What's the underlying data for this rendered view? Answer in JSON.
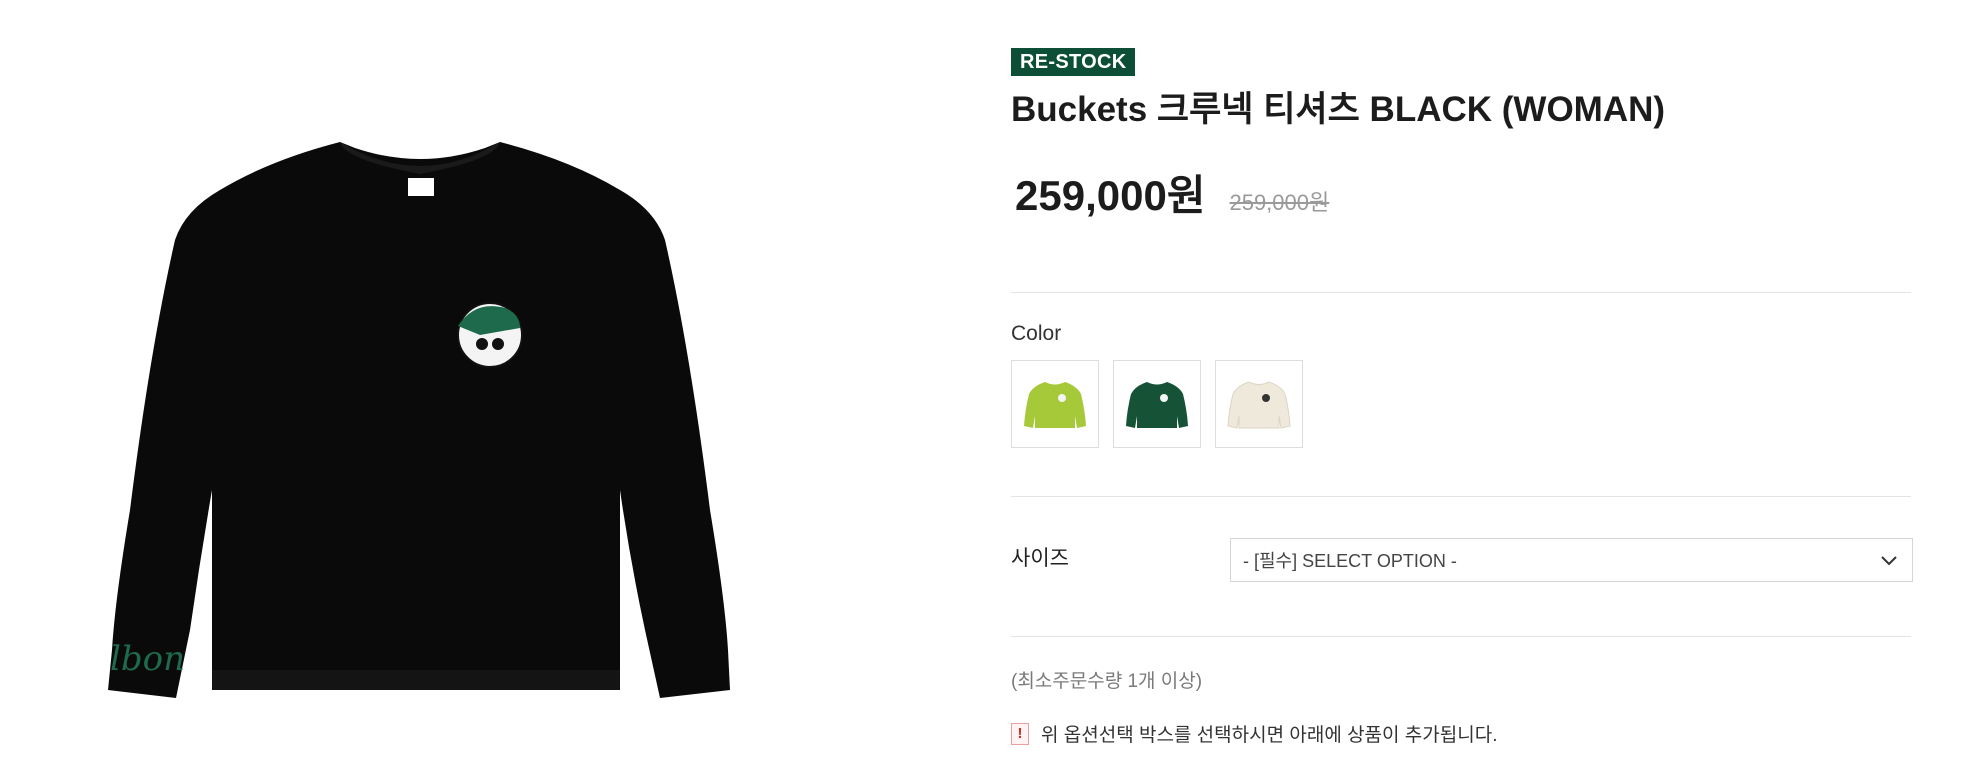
{
  "product": {
    "badge": "RE-STOCK",
    "title": "Buckets 크루넥 티셔츠 BLACK (WOMAN)",
    "price": "259,000원",
    "original_price": "259,000원",
    "main_image": {
      "icon": "black-sweatshirt-image",
      "color": "#0a0a0a"
    }
  },
  "color_option": {
    "label": "Color",
    "swatches": [
      {
        "name": "lime",
        "color": "#a6c93a",
        "icon": "lime-sweatshirt-thumbnail"
      },
      {
        "name": "green",
        "color": "#155236",
        "icon": "green-sweatshirt-thumbnail"
      },
      {
        "name": "ivory",
        "color": "#efe9dc",
        "icon": "ivory-sweatshirt-thumbnail"
      }
    ]
  },
  "size_option": {
    "label": "사이즈",
    "selected": "- [필수] SELECT OPTION -"
  },
  "min_order": "(최소주문수량 1개 이상)",
  "notice": {
    "icon": "!",
    "text": "위 옵션선택 박스를 선택하시면 아래에 상품이 추가됩니다."
  },
  "colors": {
    "badge_bg": "#0c4f36",
    "badge_text": "#ffffff",
    "text": "#1c1c1c",
    "muted": "#9a9a9a"
  }
}
